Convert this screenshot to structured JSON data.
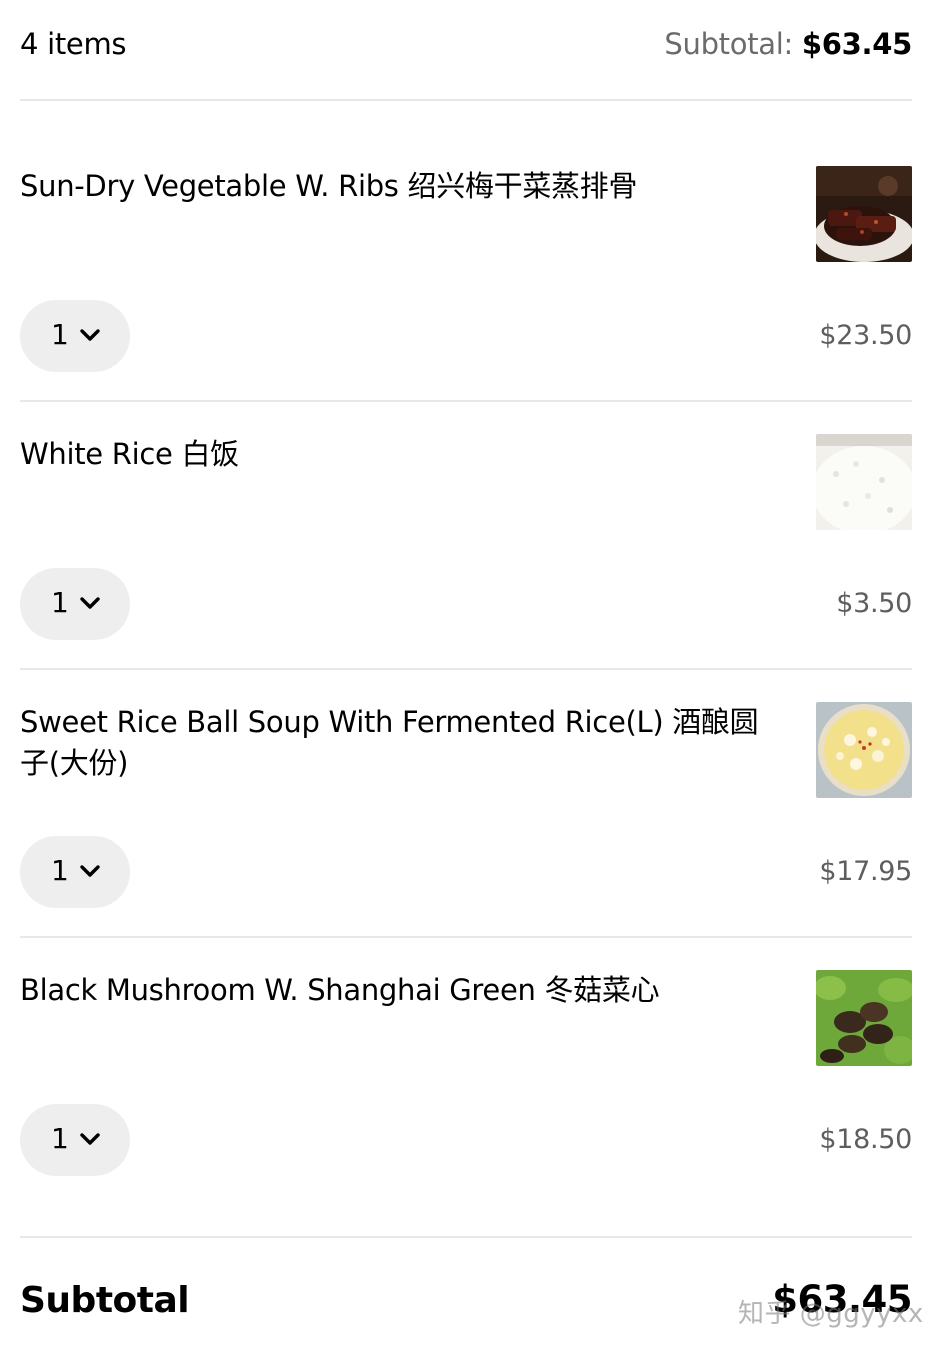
{
  "header": {
    "item_count": "4 items",
    "subtotal_label": "Subtotal: ",
    "subtotal_value": "$63.45"
  },
  "items": [
    {
      "name": "Sun-Dry Vegetable W. Ribs 绍兴梅干菜蒸排骨",
      "quantity": "1",
      "price": "$23.50",
      "image": "ribs-photo"
    },
    {
      "name": "White Rice 白饭",
      "quantity": "1",
      "price": "$3.50",
      "image": "rice-photo"
    },
    {
      "name": "Sweet Rice Ball Soup With Fermented Rice(L) 酒酿圆子(大份)",
      "quantity": "1",
      "price": "$17.95",
      "image": "soup-photo"
    },
    {
      "name": "Black Mushroom W. Shanghai Green 冬菇菜心",
      "quantity": "1",
      "price": "$18.50",
      "image": "mushroom-photo"
    }
  ],
  "footer": {
    "subtotal_label": "Subtotal",
    "subtotal_value": "$63.45"
  },
  "watermark": "知乎 @ggyyxx",
  "icons": {
    "quantity_dropdown": "chevron-down-icon"
  },
  "colors": {
    "text": "#000000",
    "muted": "#6b6b6b",
    "price": "#5e5e5e",
    "pill": "#eeeeee",
    "divider": "#e8e8e8"
  }
}
